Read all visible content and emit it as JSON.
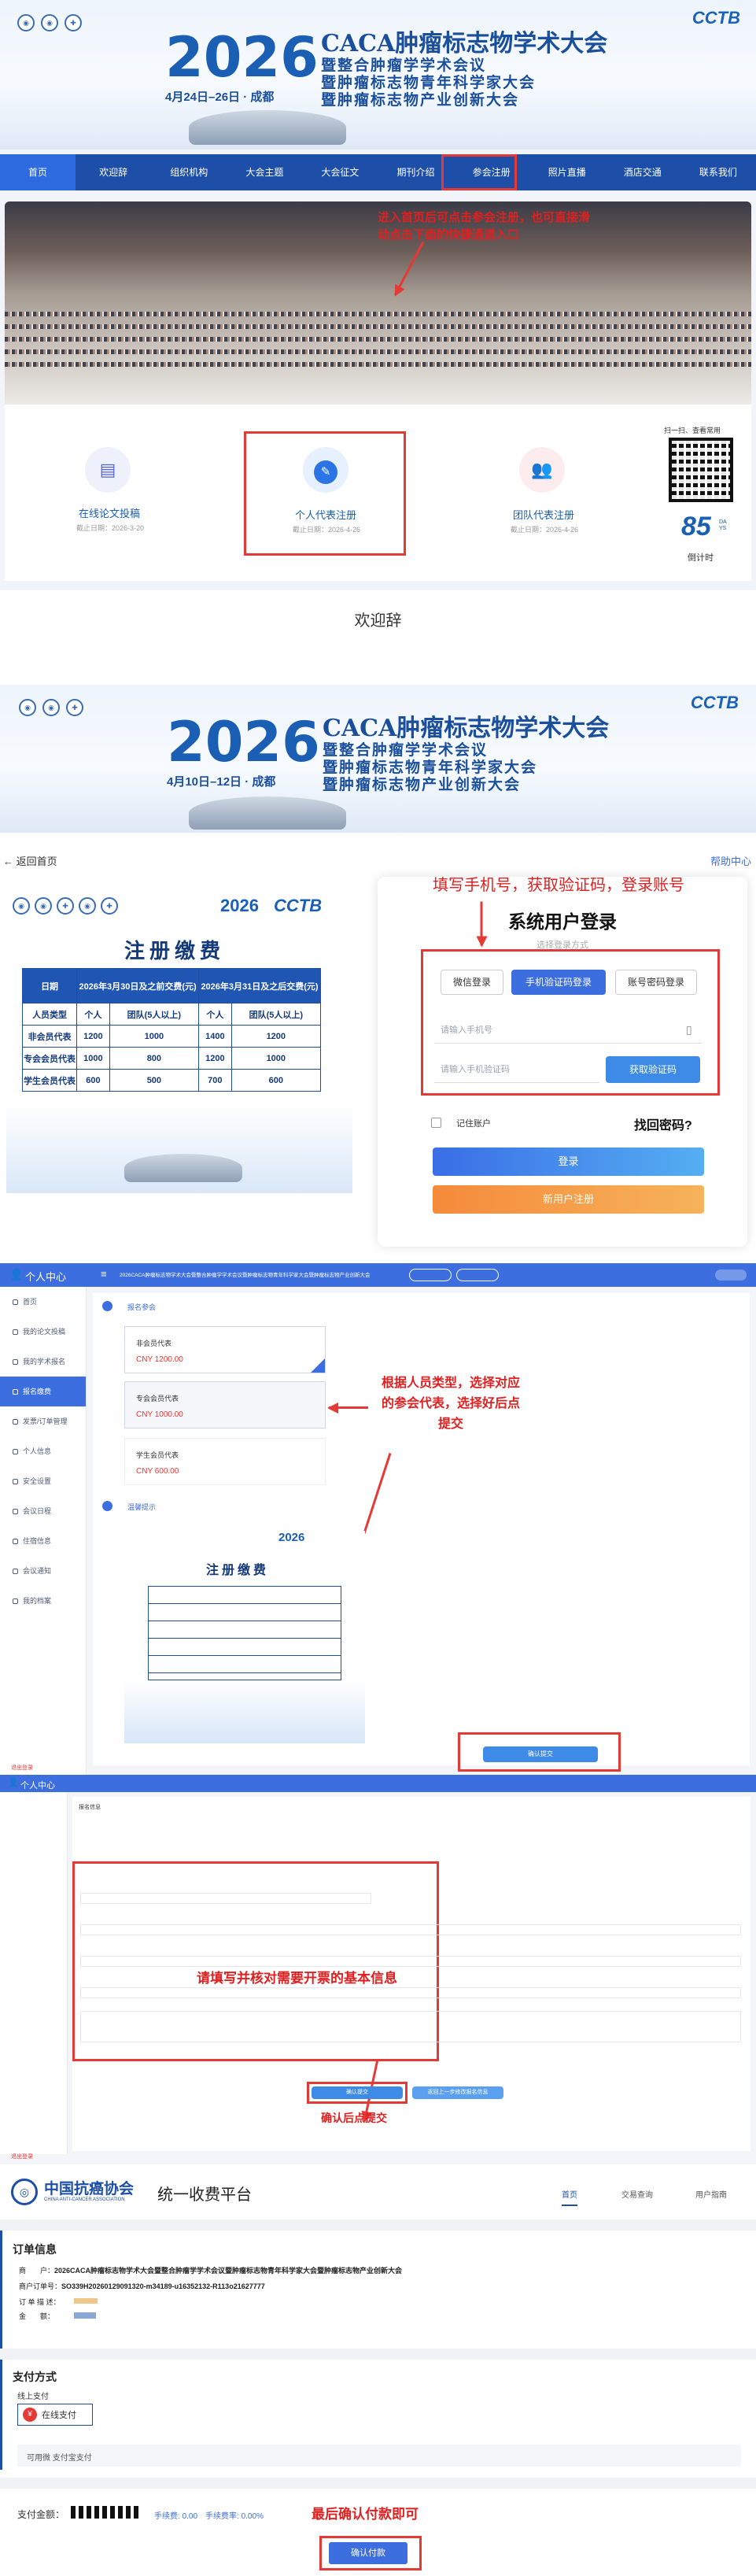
{
  "s1": {
    "org_logo_text": "CCTB",
    "year": "2026",
    "conf_title": "CACA肿瘤标志物学术大会",
    "conf_sub1": "暨整合肿瘤学学术会议",
    "conf_sub2": "暨肿瘤标志物青年科学家大会",
    "conf_sub3": "暨肿瘤标志物产业创新大会",
    "date_place": "4月24日–26日 · 成都",
    "nav": [
      "首页",
      "欢迎辞",
      "组织机构",
      "大会主题",
      "大会征文",
      "期刊介绍",
      "参会注册",
      "照片直播",
      "酒店交通",
      "联系我们"
    ],
    "annotation": "进入首页后可点击参会注册，也可直接滑动点击下面的快捷通道入口",
    "cards": [
      {
        "icon": "doc-icon",
        "title": "在线论文投稿",
        "deadline": "截止日期：2026-3-20"
      },
      {
        "icon": "pen-icon",
        "title": "个人代表注册",
        "deadline": "截止日期：2026-4-26"
      },
      {
        "icon": "group-icon",
        "title": "团队代表注册",
        "deadline": "截止日期：2026-4-26"
      }
    ],
    "qr_caption": "扫一扫、查看常用",
    "countdown_num": "85",
    "countdown_unit": "DAYS",
    "countdown_label": "倒计时",
    "welcome": "欢迎辞"
  },
  "s2": {
    "org_logo_text": "CCTB",
    "year": "2026",
    "conf_title": "CACA肿瘤标志物学术大会",
    "conf_sub1": "暨整合肿瘤学学术会议",
    "conf_sub2": "暨肿瘤标志物青年科学家大会",
    "conf_sub3": "暨肿瘤标志物产业创新大会",
    "date_place": "4月10日–12日 · 成都"
  },
  "s3": {
    "back": "返回首页",
    "help": "帮助中心",
    "annotation": "填写手机号，获取验证码，登录账号",
    "year_logo": "2026",
    "cctb": "CCTB",
    "fee_title": "注册缴费",
    "fee_table": {
      "col_date": "日期",
      "col_early": "2026年3月30日及之前交费(元)",
      "col_late": "2026年3月31日及之后交费(元)",
      "row_hdr": [
        "人员类型",
        "个人",
        "团队(5人以上)",
        "个人",
        "团队(5人以上)"
      ],
      "rows": [
        [
          "非会员代表",
          "1200",
          "1000",
          "1400",
          "1200"
        ],
        [
          "专会会员代表",
          "1000",
          "800",
          "1200",
          "1000"
        ],
        [
          "学生会员代表",
          "600",
          "500",
          "700",
          "600"
        ]
      ]
    },
    "login_title": "系统用户登录",
    "login_sub": "选择登录方式",
    "tabs": [
      "微信登录",
      "手机验证码登录",
      "账号密码登录"
    ],
    "phone_placeholder": "请输入手机号",
    "code_placeholder": "请输入手机验证码",
    "get_code": "获取验证码",
    "remember": "记住账户",
    "forgot": "找回密码?",
    "login_btn": "登录",
    "register_btn": "新用户注册"
  },
  "s4": {
    "user_center": "个人中心",
    "top_title": "2026CACA肿瘤标志物学术大会暨整合肿瘤学学术会议暨肿瘤标志物青年科学家大会暨肿瘤标志物产业创新大会",
    "side_items": [
      "首页",
      "我的论文投稿",
      "我的学术报名",
      "报名缴费",
      "发票/订单管理",
      "个人信息",
      "安全设置",
      "会议日程",
      "住宿信息",
      "会议通知",
      "我的档案"
    ],
    "step1": "报名参会",
    "options": [
      {
        "name": "非会员代表",
        "price": "CNY 1200.00"
      },
      {
        "name": "专会会员代表",
        "price": "CNY 1000.00"
      },
      {
        "name": "学生会员代表",
        "price": "CNY 600.00"
      }
    ],
    "annotation": "根据人员类型，选择对应的参会代表，选择好后点提交",
    "step2": "温馨提示",
    "fee_title": "注册缴费",
    "submit": "确认提交",
    "logout": "退出登录"
  },
  "s5": {
    "user_center": "个人中心",
    "section": "报名信息",
    "annotation": "请填写并核对需要开票的基本信息",
    "confirm_note": "确认后点提交",
    "btn_ok": "确认提交",
    "btn_back": "返回上一步修改报名信息",
    "logout": "退出登录"
  },
  "s6": {
    "org_cn": "中国抗癌协会",
    "org_en": "CHINA ANTI-CANCER ASSOCIATION",
    "platform": "统一收费平台",
    "nav": [
      "首页",
      "交易查询",
      "用户指南"
    ],
    "order_title": "订单信息",
    "order_rows": [
      {
        "k": "商　　户：",
        "v": "2026CACA肿瘤标志物学术大会暨整合肿瘤学学术会议暨肿瘤标志物青年科学家大会暨肿瘤标志物产业创新大会"
      },
      {
        "k": "商户订单号：",
        "v": "SO339H20260129091320-m34189-u16352132-R113o21627777"
      },
      {
        "k": "订 单 描 述：",
        "v": ""
      },
      {
        "k": "金　　额：",
        "v": ""
      }
    ],
    "pay_title": "支付方式",
    "online": "线上支付",
    "online_pay": "在线支付",
    "methods": "可用微 支付宝支付",
    "pay_amount_label": "支付金额：",
    "fee_info": "手续费: 0.00　手续费率: 0.00%",
    "annotation": "最后确认付款即可",
    "pay_btn": "确认付款"
  }
}
